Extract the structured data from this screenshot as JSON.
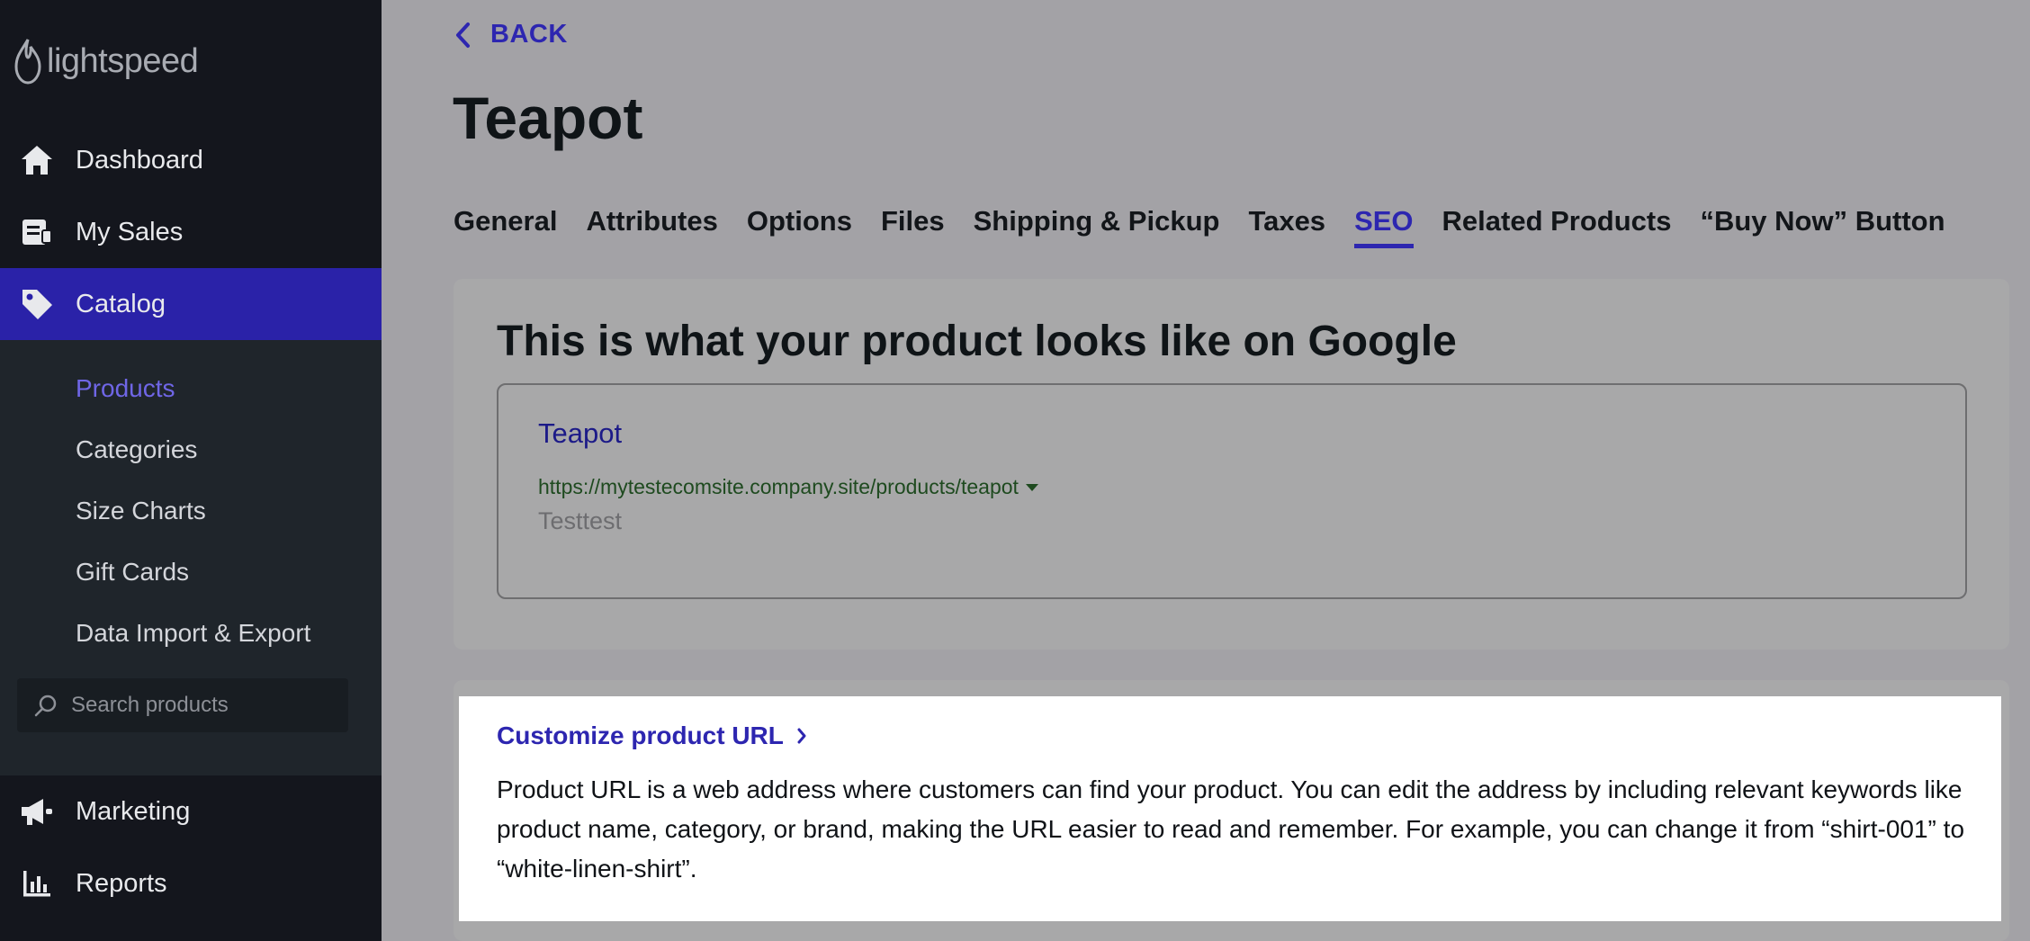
{
  "brand": {
    "name": "lightspeed"
  },
  "sidebar": {
    "items": [
      {
        "label": "Dashboard",
        "icon": "home-icon"
      },
      {
        "label": "My Sales",
        "icon": "receipt-icon"
      },
      {
        "label": "Catalog",
        "icon": "tag-icon",
        "active": true
      },
      {
        "label": "Marketing",
        "icon": "megaphone-icon"
      },
      {
        "label": "Reports",
        "icon": "bar-chart-icon"
      }
    ],
    "catalog_subitems": [
      {
        "label": "Products",
        "current": true
      },
      {
        "label": "Categories"
      },
      {
        "label": "Size Charts"
      },
      {
        "label": "Gift Cards"
      },
      {
        "label": "Data Import & Export"
      }
    ],
    "search": {
      "placeholder": "Search products"
    }
  },
  "header": {
    "back_label": "BACK",
    "title": "Teapot"
  },
  "tabs": [
    {
      "label": "General"
    },
    {
      "label": "Attributes"
    },
    {
      "label": "Options"
    },
    {
      "label": "Files"
    },
    {
      "label": "Shipping & Pickup"
    },
    {
      "label": "Taxes"
    },
    {
      "label": "SEO",
      "active": true
    },
    {
      "label": "Related Products"
    },
    {
      "label": "“Buy Now” Button"
    }
  ],
  "google_preview": {
    "heading": "This is what your product looks like on Google",
    "result_title": "Teapot",
    "result_url": "https://mytestecomsite.company.site/products/teapot",
    "result_description": "Testtest"
  },
  "customize_url": {
    "link_label": "Customize product URL",
    "description": "Product URL is a web address where customers can find your product. You can edit the address by including relevant keywords like product name, category, or brand, making the URL easier to read and remember. For example, you can change it from “shirt-001” to “white-linen-shirt”."
  },
  "colors": {
    "accent": "#2d26b0",
    "sidebar_bg": "#14161d",
    "sidebar_active": "#2a22a8",
    "overlay": "#a3a2a6",
    "url_green": "#1e4a1f"
  }
}
